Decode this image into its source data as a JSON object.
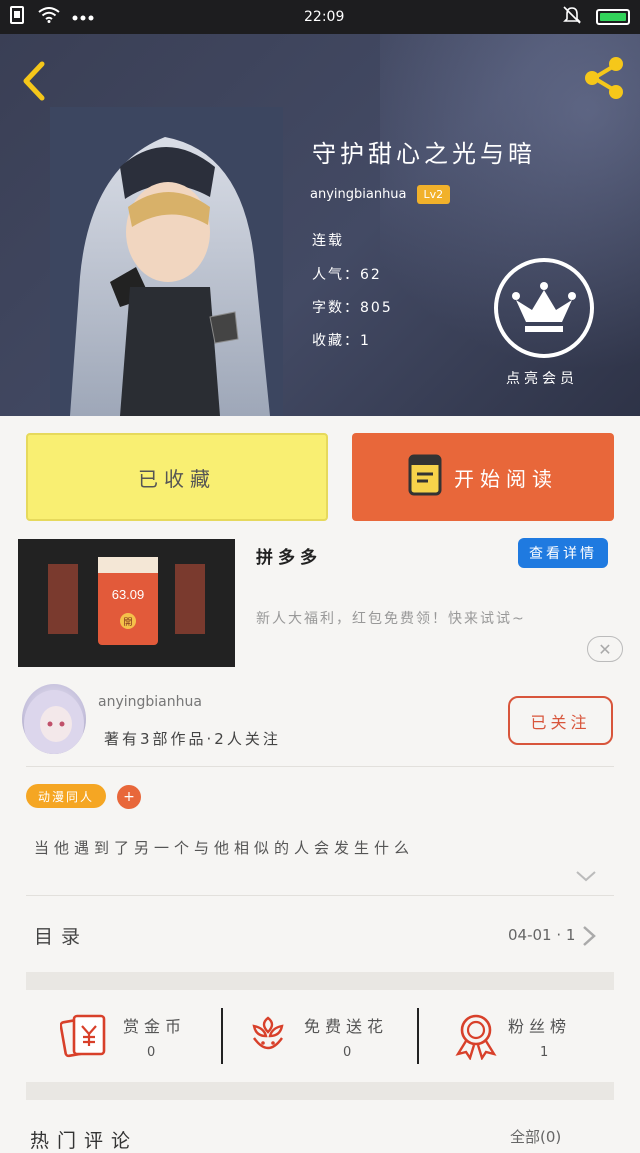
{
  "status_bar": {
    "time": "22:09",
    "battery_color": "#32d35a"
  },
  "book": {
    "title": "守护甜心之光与暗",
    "author": "anyingbianhua",
    "level": "Lv2",
    "status": "连载",
    "popularity": "人气：62",
    "word_count": "字数：805",
    "favorites": "收藏：1"
  },
  "vip": {
    "label": "点亮会员",
    "icon": "crown-icon"
  },
  "actions": {
    "collect_label": "已收藏",
    "read_label": "开始阅读"
  },
  "ad": {
    "title": "拼多多",
    "button": "查看详情",
    "description": "新人大福利，红包免费领！快来试试~",
    "image_amount": "63.09",
    "image_open": "開"
  },
  "author_card": {
    "name": "anyingbianhua",
    "stats": "著有3部作品·2人关注",
    "follow_label": "已关注"
  },
  "tags": {
    "primary": "动漫同人",
    "add": "+"
  },
  "description": "当他遇到了另一个与他相似的人会发生什么",
  "toc": {
    "label": "目录",
    "date": "04-01 · 1"
  },
  "stats": [
    {
      "label": "赏金币",
      "value": "0",
      "icon": "red-envelope-icon"
    },
    {
      "label": "免费送花",
      "value": "0",
      "icon": "flower-icon"
    },
    {
      "label": "粉丝榜",
      "value": "1",
      "icon": "medal-icon"
    }
  ],
  "hot_comments": {
    "label": "热门评论",
    "more": "全部(0)"
  },
  "colors": {
    "accent_orange": "#e8673a",
    "accent_yellow": "#f9ef72",
    "accent_blue": "#1f7ae0",
    "icon_red": "#d8402a"
  }
}
